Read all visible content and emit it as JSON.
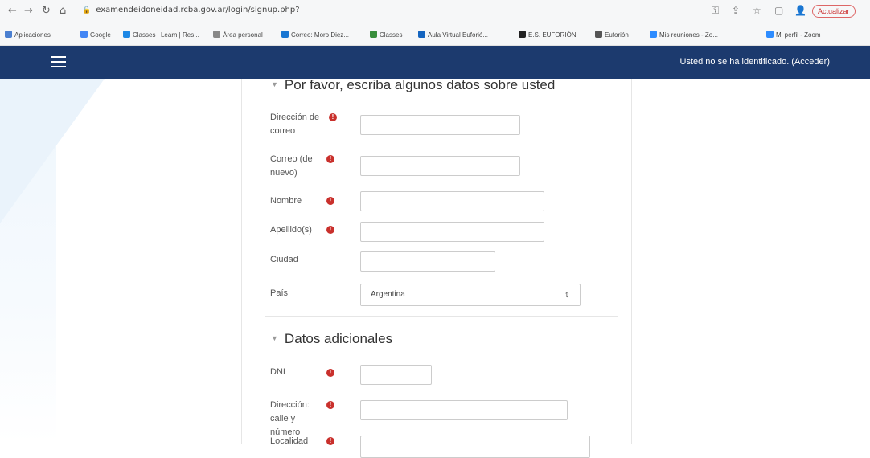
{
  "browser": {
    "url": "examendeidoneidad.rcba.gov.ar/login/signup.php?",
    "update_label": "Actualizar",
    "bookmarks": [
      {
        "label": "Aplicaciones",
        "color": "#4a7fd0"
      },
      {
        "label": "Google",
        "color": "#4285f4"
      },
      {
        "label": "Classes | Learn | Res...",
        "color": "#1e88e5"
      },
      {
        "label": "Área personal",
        "color": "#888888"
      },
      {
        "label": "Correo: Moro Diez...",
        "color": "#1976d2"
      },
      {
        "label": "Classes",
        "color": "#388e3c"
      },
      {
        "label": "Aula Virtual Euforió...",
        "color": "#1565c0"
      },
      {
        "label": "E.S. EUFORIÓN",
        "color": "#222222"
      },
      {
        "label": "Euforión",
        "color": "#555555"
      },
      {
        "label": "Mis reuniones - Zo...",
        "color": "#2d8cff"
      },
      {
        "label": "Mi perfil - Zoom",
        "color": "#2d8cff"
      }
    ]
  },
  "navbar": {
    "login_text": "Usted no se ha identificado. (Acceder)",
    "color": "#1c3a6e"
  },
  "form": {
    "section1_title": "Por favor, escriba algunos datos sobre usted",
    "section2_title": "Datos adicionales",
    "fields": {
      "email_label": "Dirección de correo",
      "email2_label": "Correo (de nuevo)",
      "nombre_label": "Nombre",
      "apellido_label": "Apellido(s)",
      "ciudad_label": "Ciudad",
      "pais_label": "País",
      "pais_value": "Argentina",
      "dni_label": "DNI",
      "direccion_label": "Dirección: calle y número",
      "localidad_label": "Localidad"
    },
    "required_icon": "!"
  }
}
